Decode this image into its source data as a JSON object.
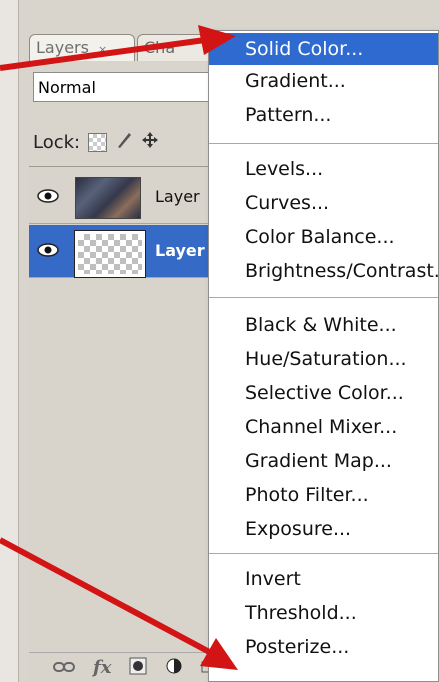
{
  "panel": {
    "tabs": [
      {
        "label": "Layers",
        "close": "×"
      },
      {
        "label": "Cha"
      }
    ],
    "blend_mode": "Normal",
    "lock_label": "Lock:",
    "layers": [
      {
        "name": "Layer",
        "thumb": "photo",
        "selected": false
      },
      {
        "name": "Layer",
        "thumb": "empty",
        "selected": true
      }
    ]
  },
  "bottom_icons": [
    "link-icon",
    "fx-icon",
    "mask-icon",
    "adjustment-icon",
    "folder-icon",
    "new-layer-icon",
    "trash-icon"
  ],
  "menu": {
    "groups": [
      [
        "Solid Color...",
        "Gradient...",
        "Pattern..."
      ],
      [
        "Levels...",
        "Curves...",
        "Color Balance...",
        "Brightness/Contrast..."
      ],
      [
        "Black & White...",
        "Hue/Saturation...",
        "Selective Color...",
        "Channel Mixer...",
        "Gradient Map...",
        "Photo Filter...",
        "Exposure..."
      ],
      [
        "Invert",
        "Threshold...",
        "Posterize..."
      ]
    ],
    "highlighted": "Solid Color..."
  },
  "colors": {
    "highlight": "#2f6ad1",
    "arrow": "#d31414",
    "selected_layer": "#356bc6"
  }
}
